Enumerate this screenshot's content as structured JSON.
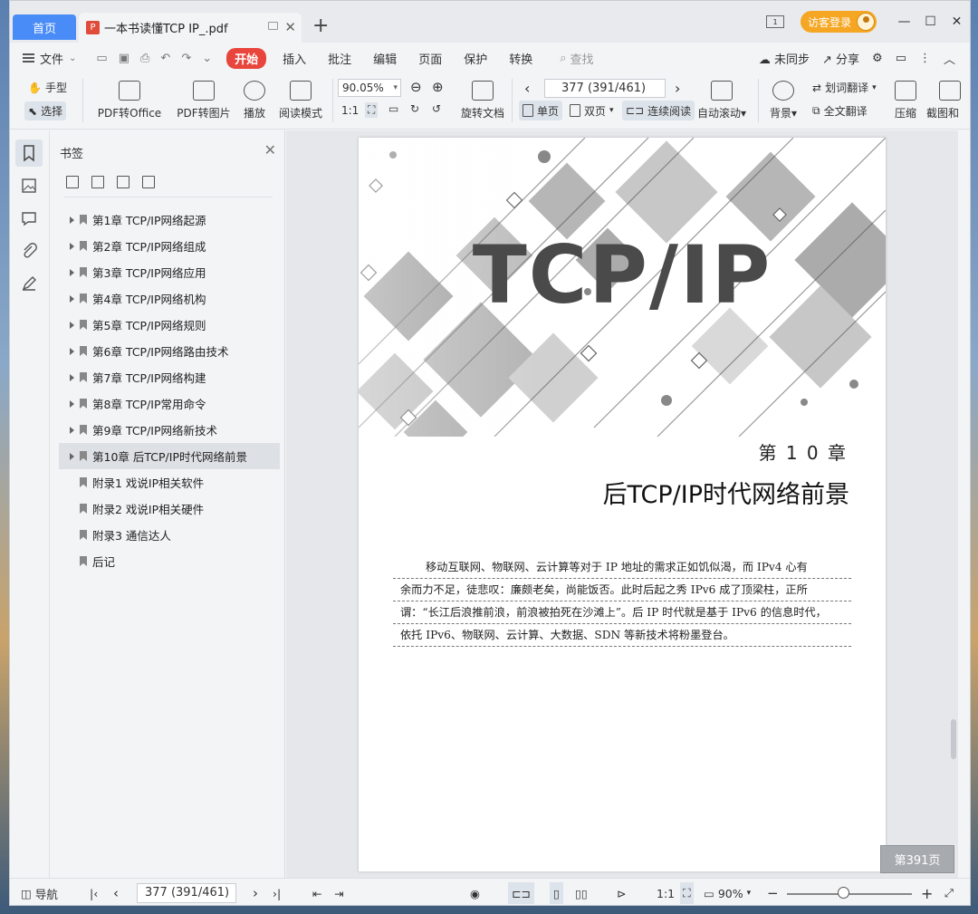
{
  "titlebar": {
    "home_tab": "首页",
    "doc_tab": "一本书读懂TCP IP_.pdf",
    "new_tab": "+",
    "login": "访客登录",
    "minimize": "—",
    "maximize": "☐",
    "close": "✕"
  },
  "menu": {
    "file": "文件",
    "items": [
      "开始",
      "插入",
      "批注",
      "编辑",
      "页面",
      "保护",
      "转换"
    ],
    "search": "查找",
    "unsync": "未同步",
    "share": "分享"
  },
  "toolbar": {
    "hand": "手型",
    "select": "选择",
    "pdf_office": "PDF转Office",
    "pdf_image": "PDF转图片",
    "play": "播放",
    "read_mode": "阅读模式",
    "zoom": "90.05%",
    "rotate_doc": "旋转文档",
    "page_value": "377 (391/461)",
    "single_page": "单页",
    "double_page": "双页",
    "continuous": "连续阅读",
    "auto_scroll": "自动滚动",
    "background": "背景",
    "word_translate": "划词翻译",
    "full_translate": "全文翻译",
    "compress": "压缩",
    "screenshot": "截图和"
  },
  "bookmarks": {
    "title": "书签",
    "items": [
      {
        "label": "第1章 TCP/IP网络起源"
      },
      {
        "label": "第2章 TCP/IP网络组成"
      },
      {
        "label": "第3章 TCP/IP网络应用"
      },
      {
        "label": "第4章 TCP/IP网络机构"
      },
      {
        "label": "第5章 TCP/IP网络规则"
      },
      {
        "label": "第6章 TCP/IP网络路由技术"
      },
      {
        "label": "第7章 TCP/IP网络构建"
      },
      {
        "label": "第8章 TCP/IP常用命令"
      },
      {
        "label": "第9章 TCP/IP网络新技术"
      },
      {
        "label": "第10章 后TCP/IP时代网络前景"
      },
      {
        "label": "附录1 戏说IP相关软件"
      },
      {
        "label": "附录2 戏说IP相关硬件"
      },
      {
        "label": "附录3 通信达人"
      },
      {
        "label": "后记"
      }
    ]
  },
  "page": {
    "cover_title": "TCP/IP",
    "chapter_number": "第 1 0 章",
    "chapter_title": "后TCP/IP时代网络前景",
    "intro_lines": [
      "移动互联网、物联网、云计算等对于 IP 地址的需求正如饥似渴，而 IPv4 心有",
      "余而力不足，徒悲叹：廉颇老矣，尚能饭否。此时后起之秀 IPv6 成了顶梁柱，正所",
      "谓：“长江后浪推前浪，前浪被拍死在沙滩上”。后 IP 时代就是基于 IPv6 的信息时代，",
      "依托 IPv6、物联网、云计算、大数据、SDN 等新技术将粉墨登台。"
    ],
    "page_badge": "第391页"
  },
  "statusbar": {
    "nav": "导航",
    "page_value": "377 (391/461)",
    "zoom": "90%",
    "minus": "−",
    "plus": "+"
  }
}
